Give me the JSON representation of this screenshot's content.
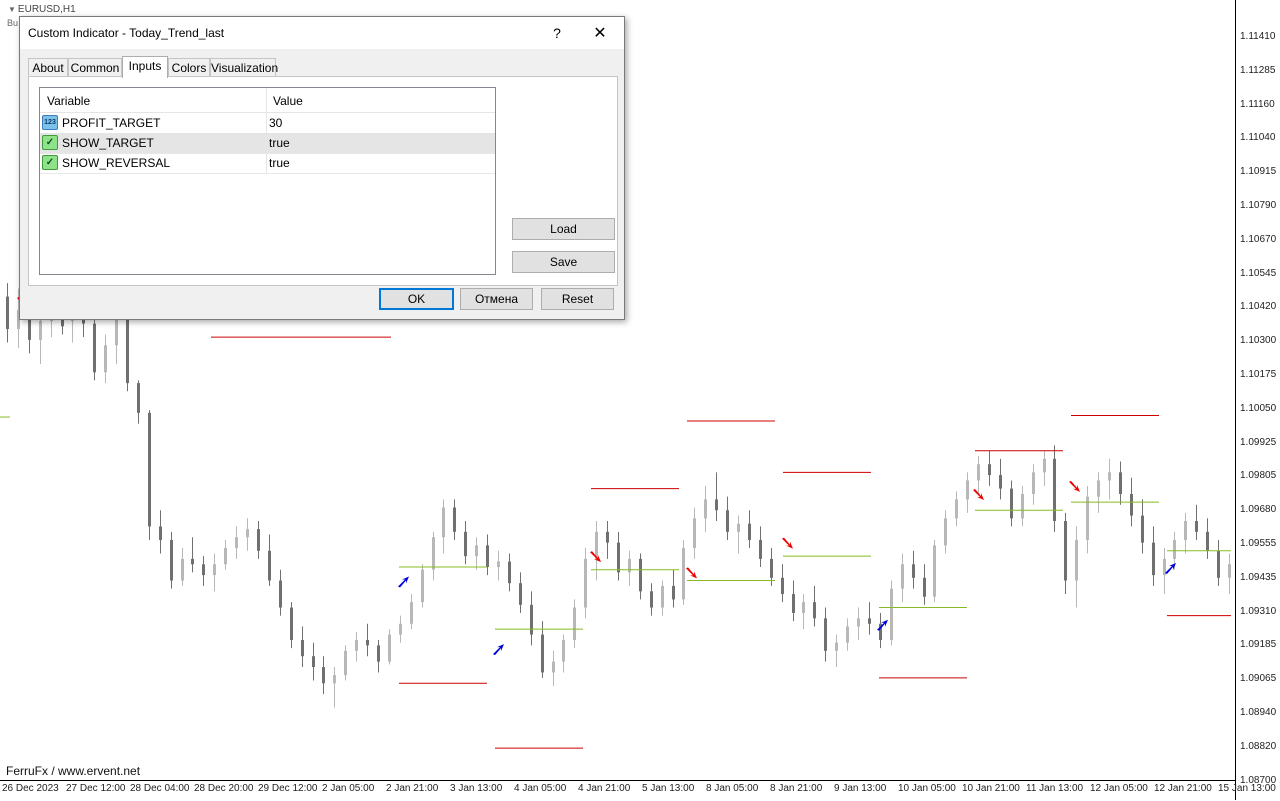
{
  "chart": {
    "symbol": "EURUSD,H1",
    "subtitle": "Bu",
    "watermark": "FerruFx / www.ervent.net",
    "price_labels": [
      "1.11410",
      "1.11285",
      "1.11160",
      "1.11040",
      "1.10915",
      "1.10790",
      "1.10670",
      "1.10545",
      "1.10420",
      "1.10300",
      "1.10175",
      "1.10050",
      "1.09925",
      "1.09805",
      "1.09680",
      "1.09555",
      "1.09435",
      "1.09310",
      "1.09185",
      "1.09065",
      "1.08940",
      "1.08820",
      "1.08700"
    ],
    "time_labels": [
      "26 Dec 2023",
      "27 Dec 12:00",
      "28 Dec 04:00",
      "28 Dec 20:00",
      "29 Dec 12:00",
      "2 Jan 05:00",
      "2 Jan 21:00",
      "3 Jan 13:00",
      "4 Jan 05:00",
      "4 Jan 21:00",
      "5 Jan 13:00",
      "8 Jan 05:00",
      "8 Jan 21:00",
      "9 Jan 13:00",
      "10 Jan 05:00",
      "10 Jan 21:00",
      "11 Jan 13:00",
      "12 Jan 05:00",
      "12 Jan 21:00",
      "15 Jan 13:00"
    ],
    "colors": {
      "bull_candle": "#b8b8b8",
      "bear_candle": "#707070",
      "target_line": "#cc0000",
      "reversal_line": "#88bb22",
      "buy_arrow": "#0000dd",
      "sell_arrow": "#ee0000"
    },
    "candles": [
      [
        1.1045,
        1.105,
        1.1028,
        1.1033
      ],
      [
        1.1033,
        1.1048,
        1.1026,
        1.104
      ],
      [
        1.104,
        1.1043,
        1.1024,
        1.1029
      ],
      [
        1.1029,
        1.1041,
        1.102,
        1.1036
      ],
      [
        1.1036,
        1.1045,
        1.103,
        1.1038
      ],
      [
        1.1038,
        1.1044,
        1.1031,
        1.1034
      ],
      [
        1.1036,
        1.1047,
        1.1028,
        1.1041
      ],
      [
        1.1041,
        1.1049,
        1.103,
        1.1035
      ],
      [
        1.1035,
        1.104,
        1.1014,
        1.1017
      ],
      [
        1.1017,
        1.1031,
        1.1013,
        1.1027
      ],
      [
        1.1027,
        1.1047,
        1.102,
        1.1042
      ],
      [
        1.1042,
        1.1043,
        1.101,
        1.1013
      ],
      [
        1.1013,
        1.1014,
        1.0998,
        1.1002
      ],
      [
        1.1002,
        1.1003,
        1.0955,
        1.096
      ],
      [
        1.096,
        1.0966,
        1.095,
        1.0955
      ],
      [
        1.0955,
        1.0958,
        1.0937,
        1.094
      ],
      [
        1.094,
        1.0952,
        1.0938,
        1.0948
      ],
      [
        1.0948,
        1.0956,
        1.0943,
        1.0946
      ],
      [
        1.0946,
        1.0949,
        1.0938,
        1.0942
      ],
      [
        1.0942,
        1.095,
        1.0936,
        1.0946
      ],
      [
        1.0946,
        1.0955,
        1.0944,
        1.0952
      ],
      [
        1.0952,
        1.096,
        1.0948,
        1.0956
      ],
      [
        1.0956,
        1.0963,
        1.0951,
        1.0959
      ],
      [
        1.0959,
        1.0962,
        1.0948,
        1.0951
      ],
      [
        1.0951,
        1.0957,
        1.0938,
        1.094
      ],
      [
        1.094,
        1.0944,
        1.0927,
        1.093
      ],
      [
        1.093,
        1.0932,
        1.0915,
        1.0918
      ],
      [
        1.0918,
        1.0923,
        1.0908,
        1.0912
      ],
      [
        1.0912,
        1.0917,
        1.0903,
        1.0908
      ],
      [
        1.0908,
        1.0912,
        1.0898,
        1.0902
      ],
      [
        1.0902,
        1.0908,
        1.0893,
        1.0905
      ],
      [
        1.0905,
        1.0916,
        1.0903,
        1.0914
      ],
      [
        1.0914,
        1.0921,
        1.091,
        1.0918
      ],
      [
        1.0918,
        1.0924,
        1.0912,
        1.0916
      ],
      [
        1.0916,
        1.0918,
        1.0906,
        1.091
      ],
      [
        1.091,
        1.0922,
        1.0909,
        1.092
      ],
      [
        1.092,
        1.0927,
        1.0917,
        1.0924
      ],
      [
        1.0924,
        1.0935,
        1.0922,
        1.0932
      ],
      [
        1.0932,
        1.0946,
        1.093,
        1.0944
      ],
      [
        1.0944,
        1.0958,
        1.094,
        1.0956
      ],
      [
        1.0956,
        1.097,
        1.095,
        1.0967
      ],
      [
        1.0967,
        1.097,
        1.0955,
        1.0958
      ],
      [
        1.0958,
        1.0962,
        1.0946,
        1.0949
      ],
      [
        1.0949,
        1.0956,
        1.0944,
        1.0953
      ],
      [
        1.0953,
        1.0957,
        1.0942,
        1.0945
      ],
      [
        1.0945,
        1.0951,
        1.094,
        1.0947
      ],
      [
        1.0947,
        1.095,
        1.0936,
        1.0939
      ],
      [
        1.0939,
        1.0943,
        1.0928,
        1.0931
      ],
      [
        1.0931,
        1.0936,
        1.0916,
        1.092
      ],
      [
        1.092,
        1.0925,
        1.0904,
        1.0906
      ],
      [
        1.0906,
        1.0914,
        1.0901,
        1.091
      ],
      [
        1.091,
        1.092,
        1.0906,
        1.0918
      ],
      [
        1.0918,
        1.0933,
        1.0915,
        1.093
      ],
      [
        1.093,
        1.0952,
        1.0926,
        1.0948
      ],
      [
        1.0948,
        1.0962,
        1.094,
        1.0958
      ],
      [
        1.0958,
        1.0962,
        1.0948,
        1.0954
      ],
      [
        1.0954,
        1.0958,
        1.094,
        1.0943
      ],
      [
        1.0943,
        1.0951,
        1.0938,
        1.0948
      ],
      [
        1.0948,
        1.095,
        1.0933,
        1.0936
      ],
      [
        1.0936,
        1.0939,
        1.0927,
        1.093
      ],
      [
        1.093,
        1.094,
        1.0927,
        1.0938
      ],
      [
        1.0938,
        1.0944,
        1.093,
        1.0933
      ],
      [
        1.0933,
        1.0955,
        1.0931,
        1.0952
      ],
      [
        1.0952,
        1.0967,
        1.0948,
        1.0963
      ],
      [
        1.0963,
        1.0975,
        1.0958,
        1.097
      ],
      [
        1.097,
        1.098,
        1.0962,
        1.0966
      ],
      [
        1.0966,
        1.0971,
        1.0955,
        1.0958
      ],
      [
        1.0958,
        1.0964,
        1.095,
        1.0961
      ],
      [
        1.0961,
        1.0966,
        1.0952,
        1.0955
      ],
      [
        1.0955,
        1.096,
        1.0945,
        1.0948
      ],
      [
        1.0948,
        1.0952,
        1.0938,
        1.0941
      ],
      [
        1.0941,
        1.0946,
        1.0932,
        1.0935
      ],
      [
        1.0935,
        1.094,
        1.0925,
        1.0928
      ],
      [
        1.0928,
        1.0935,
        1.0922,
        1.0932
      ],
      [
        1.0932,
        1.0938,
        1.0923,
        1.0926
      ],
      [
        1.0926,
        1.093,
        1.091,
        1.0914
      ],
      [
        1.0914,
        1.092,
        1.0908,
        1.0917
      ],
      [
        1.0917,
        1.0926,
        1.0914,
        1.0923
      ],
      [
        1.0923,
        1.093,
        1.0918,
        1.0926
      ],
      [
        1.0926,
        1.0932,
        1.092,
        1.0924
      ],
      [
        1.0924,
        1.0928,
        1.0915,
        1.0918
      ],
      [
        1.0918,
        1.094,
        1.0916,
        1.0937
      ],
      [
        1.0937,
        1.095,
        1.0932,
        1.0946
      ],
      [
        1.0946,
        1.0951,
        1.0937,
        1.0941
      ],
      [
        1.0941,
        1.0946,
        1.0931,
        1.0934
      ],
      [
        1.0934,
        1.0955,
        1.0932,
        1.0953
      ],
      [
        1.0953,
        1.0966,
        1.095,
        1.0963
      ],
      [
        1.0963,
        1.0973,
        1.096,
        1.097
      ],
      [
        1.097,
        1.098,
        1.0965,
        1.0977
      ],
      [
        1.0977,
        1.0986,
        1.0972,
        1.0983
      ],
      [
        1.0983,
        1.0988,
        1.0975,
        1.0979
      ],
      [
        1.0979,
        1.0985,
        1.097,
        1.0974
      ],
      [
        1.0974,
        1.0977,
        1.096,
        1.0963
      ],
      [
        1.0963,
        1.0975,
        1.096,
        1.0972
      ],
      [
        1.0972,
        1.0983,
        1.0968,
        1.098
      ],
      [
        1.098,
        1.0988,
        1.0975,
        1.0985
      ],
      [
        1.0985,
        1.099,
        1.0958,
        1.0962
      ],
      [
        1.0962,
        1.0965,
        1.0935,
        1.094
      ],
      [
        1.094,
        1.096,
        1.093,
        1.0955
      ],
      [
        1.0955,
        1.0975,
        1.095,
        1.0971
      ],
      [
        1.0971,
        1.098,
        1.0965,
        1.0977
      ],
      [
        1.0977,
        1.0985,
        1.097,
        1.098
      ],
      [
        1.098,
        1.0984,
        1.0968,
        1.0972
      ],
      [
        1.0972,
        1.0978,
        1.096,
        1.0964
      ],
      [
        1.0964,
        1.097,
        1.095,
        1.0954
      ],
      [
        1.0954,
        1.096,
        1.0938,
        1.0942
      ],
      [
        1.0942,
        1.0952,
        1.0935,
        1.0948
      ],
      [
        1.0948,
        1.0958,
        1.0944,
        1.0955
      ],
      [
        1.0955,
        1.0965,
        1.095,
        1.0962
      ],
      [
        1.0962,
        1.0968,
        1.0955,
        1.0958
      ],
      [
        1.0958,
        1.0963,
        1.0948,
        1.0951
      ],
      [
        1.0951,
        1.0955,
        1.0938,
        1.0941
      ],
      [
        1.0941,
        1.095,
        1.0935,
        1.0946
      ]
    ],
    "target_lines": [
      [
        211,
        391,
        1.103
      ],
      [
        399,
        487,
        1.0902
      ],
      [
        495,
        583,
        1.0878
      ],
      [
        591,
        679,
        1.0974
      ],
      [
        687,
        775,
        1.0999
      ],
      [
        783,
        871,
        1.098
      ],
      [
        879,
        967,
        1.0904
      ],
      [
        975,
        1063,
        1.0988
      ],
      [
        1071,
        1159,
        1.1001
      ],
      [
        1167,
        1231,
        1.0927
      ]
    ],
    "reversal_lines": [
      [
        399,
        487,
        1.0945
      ],
      [
        495,
        583,
        1.0922
      ],
      [
        591,
        679,
        1.0944
      ],
      [
        687,
        775,
        1.094
      ],
      [
        783,
        871,
        1.0949
      ],
      [
        879,
        967,
        1.093
      ],
      [
        975,
        1063,
        1.0966
      ],
      [
        1071,
        1159,
        1.0969
      ],
      [
        1167,
        1231,
        1.0951
      ]
    ],
    "buy_arrows": [
      [
        398,
        1.094
      ],
      [
        493,
        1.0915
      ],
      [
        877,
        1.0924
      ],
      [
        1165,
        1.0945
      ]
    ],
    "sell_arrows": [
      [
        17,
        1.1043
      ],
      [
        590,
        1.0949
      ],
      [
        686,
        1.0943
      ],
      [
        782,
        1.0954
      ],
      [
        973,
        1.0972
      ],
      [
        1069,
        1.0975
      ]
    ]
  },
  "dialog": {
    "title": "Custom Indicator - Today_Trend_last",
    "help_label": "?",
    "close_label": "✕",
    "tabs": [
      {
        "label": "About"
      },
      {
        "label": "Common"
      },
      {
        "label": "Inputs"
      },
      {
        "label": "Colors"
      },
      {
        "label": "Visualization"
      }
    ],
    "grid": {
      "headers": {
        "variable": "Variable",
        "value": "Value"
      },
      "rows": [
        {
          "name": "PROFIT_TARGET",
          "value": "30",
          "icon": "123"
        },
        {
          "name": "SHOW_TARGET",
          "value": "true",
          "icon": "✓"
        },
        {
          "name": "SHOW_REVERSAL",
          "value": "true",
          "icon": "✓"
        }
      ]
    },
    "load_label": "Load",
    "save_label": "Save",
    "ok_label": "OK",
    "cancel_label": "Отмена",
    "reset_label": "Reset"
  }
}
